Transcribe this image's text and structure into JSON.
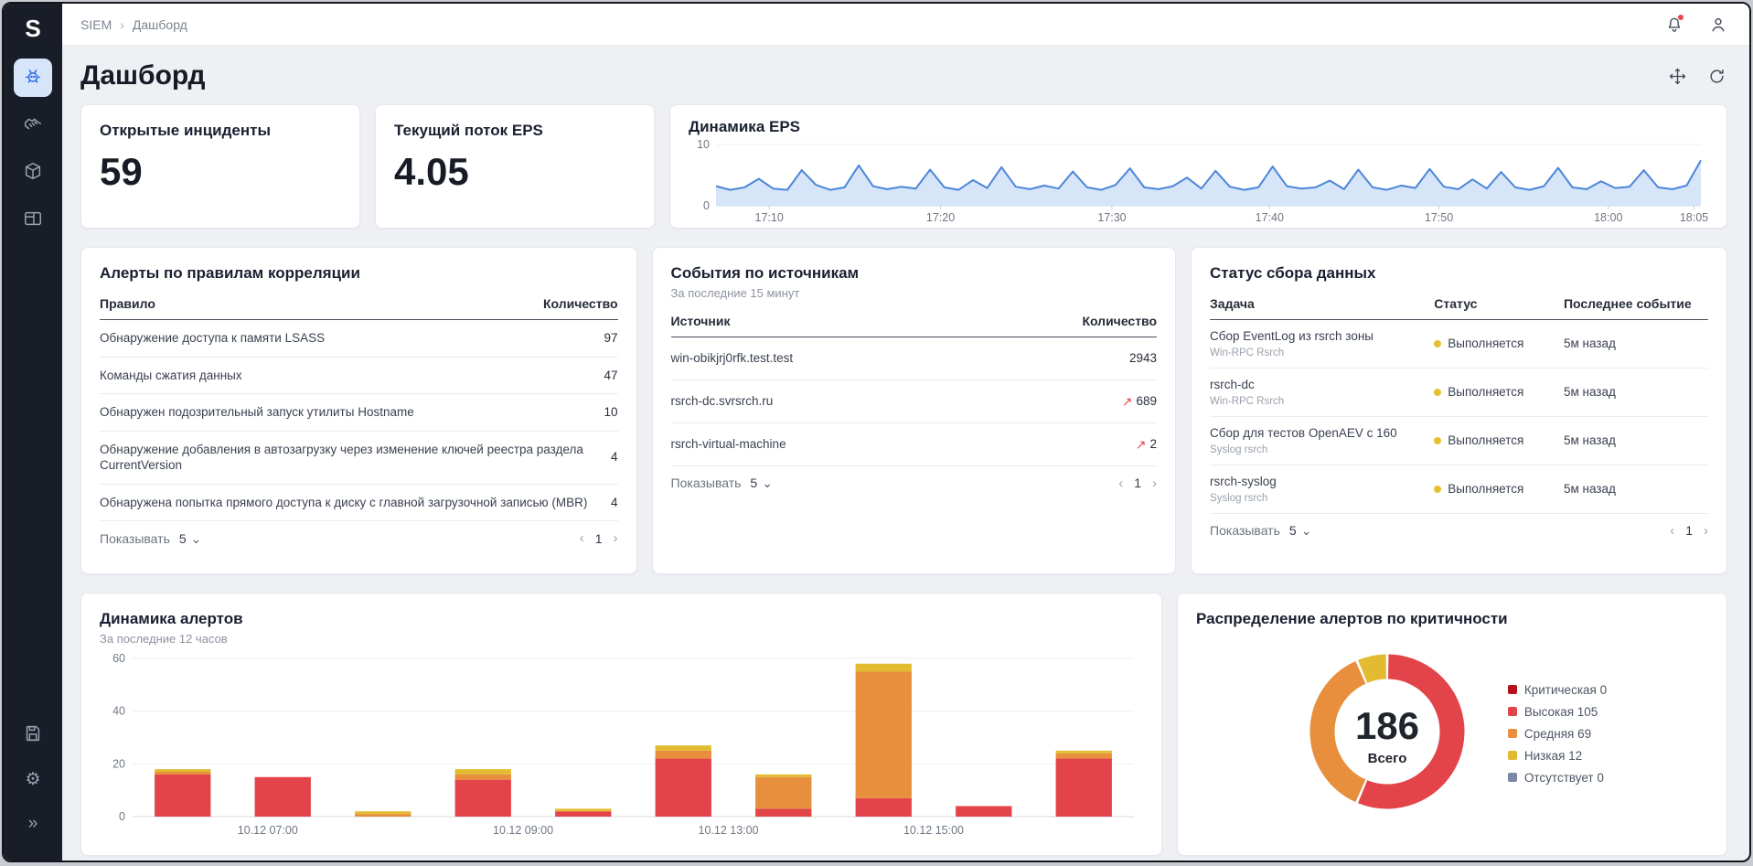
{
  "app": {
    "logo": "S",
    "breadcrumb": {
      "root": "SIEM",
      "separator": "›",
      "current": "Дашборд"
    },
    "page_title": "Дашборд"
  },
  "icons": {
    "gear": "⚙",
    "collapse": "»",
    "chevron_down": "⌄",
    "page_prev": "‹",
    "page_next": "›",
    "trend_up": "↗"
  },
  "pager": {
    "show_label": "Показывать",
    "show_value": "5",
    "page": "1"
  },
  "kpi_incidents": {
    "title": "Открытые инциденты",
    "value": "59"
  },
  "kpi_eps": {
    "title": "Текущий поток EPS",
    "value": "4.05"
  },
  "eps_card": {
    "title": "Динамика EPS"
  },
  "alert_rules": {
    "title": "Алерты по правилам корреляции",
    "col_rule": "Правило",
    "col_count": "Количество",
    "rows": [
      {
        "rule": "Обнаружение доступа к памяти LSASS",
        "count": "97"
      },
      {
        "rule": "Команды сжатия данных",
        "count": "47"
      },
      {
        "rule": "Обнаружен подозрительный запуск утилиты Hostname",
        "count": "10"
      },
      {
        "rule": "Обнаружение добавления в автозагрузку через изменение ключей реестра раздела CurrentVersion",
        "count": "4"
      },
      {
        "rule": "Обнаружена попытка прямого доступа к диску с главной загрузочной записью (MBR)",
        "count": "4"
      }
    ]
  },
  "event_sources": {
    "title": "События по источникам",
    "subtitle": "За последние 15 минут",
    "col_source": "Источник",
    "col_count": "Количество",
    "rows": [
      {
        "source": "win-obikjrj0rfk.test.test",
        "count": "2943",
        "trend": false
      },
      {
        "source": "rsrch-dc.svrsrch.ru",
        "count": "689",
        "trend": true
      },
      {
        "source": "rsrch-virtual-machine",
        "count": "2",
        "trend": true
      }
    ]
  },
  "collect_status": {
    "title": "Статус сбора данных",
    "col_task": "Задача",
    "col_status": "Статус",
    "col_last": "Последнее событие",
    "rows": [
      {
        "task": "Сбор EventLog из rsrch зоны",
        "sub": "Win-RPC Rsrch",
        "status": "Выполняется",
        "last": "5м назад"
      },
      {
        "task": "rsrch-dc",
        "sub": "Win-RPC Rsrch",
        "status": "Выполняется",
        "last": "5м назад"
      },
      {
        "task": "Сбор для тестов OpenAEV с 160",
        "sub": "Syslog rsrch",
        "status": "Выполняется",
        "last": "5м назад"
      },
      {
        "task": "rsrch-syslog",
        "sub": "Syslog rsrch",
        "status": "Выполняется",
        "last": "5м назад"
      }
    ]
  },
  "alert_dynamics": {
    "title": "Динамика алертов",
    "subtitle": "За последние 12 часов"
  },
  "severity": {
    "title": "Распределение алертов по критичности"
  },
  "chart_data": [
    {
      "id": "eps",
      "type": "area",
      "title": "Динамика EPS",
      "ylabel": "",
      "ylim": [
        0,
        10
      ],
      "y_ticks": [
        0,
        10
      ],
      "x_ticks": [
        {
          "label": "17:10",
          "pos": 0.054
        },
        {
          "label": "17:20",
          "pos": 0.228
        },
        {
          "label": "17:30",
          "pos": 0.402
        },
        {
          "label": "17:40",
          "pos": 0.562
        },
        {
          "label": "17:50",
          "pos": 0.734
        },
        {
          "label": "18:00",
          "pos": 0.906
        },
        {
          "label": "18:05",
          "pos": 0.993
        }
      ],
      "line_color": "#4c86d9",
      "fill_color": "#d6e5f8",
      "values": [
        3.2,
        2.6,
        3.0,
        4.4,
        2.8,
        2.6,
        5.8,
        3.4,
        2.6,
        3.0,
        6.6,
        3.2,
        2.7,
        3.1,
        2.8,
        5.9,
        3.0,
        2.6,
        4.2,
        2.9,
        6.3,
        3.1,
        2.7,
        3.3,
        2.8,
        5.6,
        3.0,
        2.6,
        3.4,
        6.1,
        3.0,
        2.7,
        3.2,
        4.6,
        2.8,
        5.7,
        3.1,
        2.6,
        3.0,
        6.4,
        3.2,
        2.8,
        3.0,
        4.1,
        2.7,
        5.9,
        3.0,
        2.6,
        3.3,
        2.9,
        6.0,
        3.1,
        2.7,
        4.3,
        2.8,
        5.5,
        3.0,
        2.6,
        3.2,
        6.2,
        3.0,
        2.7,
        4.0,
        2.9,
        3.1,
        5.8,
        3.0,
        2.7,
        3.3,
        7.4
      ]
    },
    {
      "id": "alerts",
      "type": "bar",
      "stacked": true,
      "title": "Динамика алертов",
      "ylim": [
        0,
        60
      ],
      "y_ticks": [
        0,
        20,
        40,
        60
      ],
      "x_ticks": [
        {
          "label": "10.12 07:00",
          "pos": 0.135
        },
        {
          "label": "10.12 09:00",
          "pos": 0.39
        },
        {
          "label": "10.12 13:00",
          "pos": 0.595
        },
        {
          "label": "10.12 15:00",
          "pos": 0.8
        }
      ],
      "series": [
        {
          "name": "Высокая",
          "color": "#e2444a",
          "values": [
            16,
            15,
            0,
            14,
            2,
            22,
            3,
            7,
            4,
            22
          ]
        },
        {
          "name": "Средняя",
          "color": "#e78f3c",
          "values": [
            1,
            0,
            1,
            2,
            0,
            3,
            12,
            48,
            0,
            2
          ]
        },
        {
          "name": "Низкая",
          "color": "#e3bb31",
          "values": [
            1,
            0,
            1,
            2,
            1,
            2,
            1,
            3,
            0,
            1
          ]
        }
      ]
    },
    {
      "id": "severity",
      "type": "pie",
      "donut": true,
      "title": "Распределение алертов по критичности",
      "center_value": "186",
      "center_label": "Всего",
      "legend_position": "right",
      "slices": [
        {
          "label": "Критическая",
          "value": 0,
          "color": "#b5121b"
        },
        {
          "label": "Высокая",
          "value": 105,
          "color": "#e2444a"
        },
        {
          "label": "Средняя",
          "value": 69,
          "color": "#e78f3c"
        },
        {
          "label": "Низкая",
          "value": 12,
          "color": "#e3bb31"
        },
        {
          "label": "Отсутствует",
          "value": 0,
          "color": "#7b88a8"
        }
      ]
    }
  ]
}
